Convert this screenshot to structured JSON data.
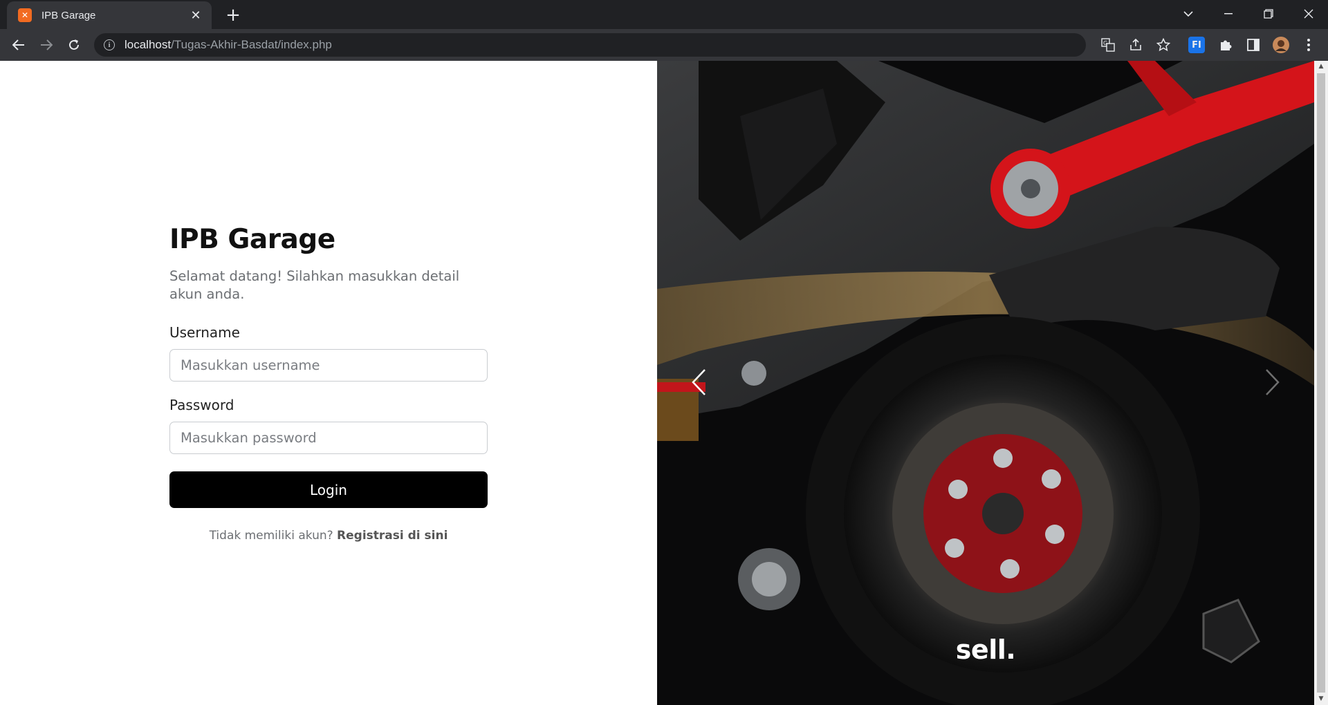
{
  "browser": {
    "tab_title": "IPB Garage",
    "tab_favicon": "xampp-icon",
    "url_host": "localhost",
    "url_path": "/Tugas-Akhir-Basdat/index.php",
    "extension_badge": "FI"
  },
  "login": {
    "title": "IPB Garage",
    "subtitle": "Selamat datang! Silahkan masukkan detail akun anda.",
    "username_label": "Username",
    "username_placeholder": "Masukkan username",
    "username_value": "",
    "password_label": "Password",
    "password_placeholder": "Masukkan password",
    "password_value": "",
    "login_button": "Login",
    "register_prompt": "Tidak memiliki akun?",
    "register_link": "Registrasi di sini"
  },
  "carousel": {
    "caption": "sell.",
    "prev_icon": "chevron-left-icon",
    "next_icon": "chevron-right-icon"
  }
}
